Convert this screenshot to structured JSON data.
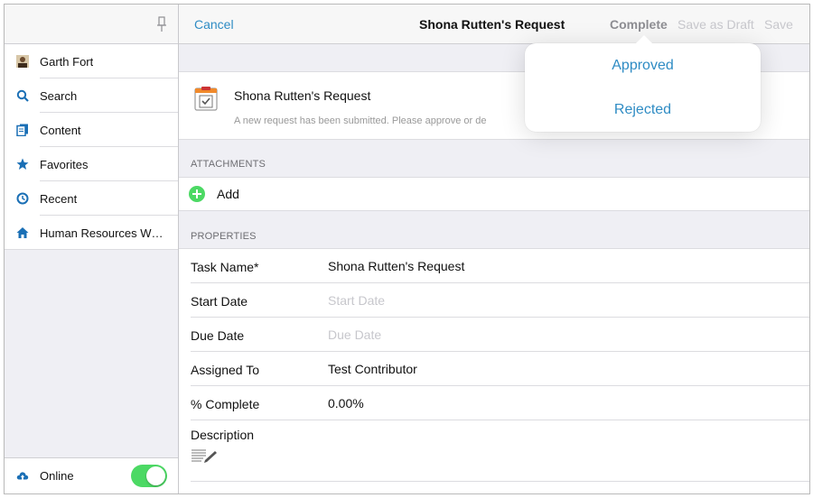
{
  "sidebar": {
    "items": [
      {
        "label": "Garth Fort",
        "icon": "user-avatar-icon"
      },
      {
        "label": "Search",
        "icon": "search-icon"
      },
      {
        "label": "Content",
        "icon": "documents-icon"
      },
      {
        "label": "Favorites",
        "icon": "star-icon"
      },
      {
        "label": "Recent",
        "icon": "clock-icon"
      },
      {
        "label": "Human Resources W…",
        "icon": "home-icon"
      }
    ],
    "footer": {
      "label": "Online",
      "icon": "cloud-upload-icon",
      "toggle_on": true
    }
  },
  "navbar": {
    "cancel_label": "Cancel",
    "title": "Shona Rutten's Request",
    "complete_label": "Complete",
    "save_draft_label": "Save as Draft",
    "save_label": "Save"
  },
  "request": {
    "title": "Shona Rutten's Request",
    "subtitle": "A new request has been submitted. Please approve or de",
    "icon": "task-checklist-icon"
  },
  "attachments": {
    "header": "ATTACHMENTS",
    "add_label": "Add"
  },
  "properties": {
    "header": "PROPERTIES",
    "rows": [
      {
        "label": "Task Name*",
        "value": "Shona Rutten's Request",
        "placeholder": false
      },
      {
        "label": "Start Date",
        "value": "Start Date",
        "placeholder": true
      },
      {
        "label": "Due Date",
        "value": "Due Date",
        "placeholder": true
      },
      {
        "label": "Assigned To",
        "value": "Test Contributor",
        "placeholder": false
      },
      {
        "label": "% Complete",
        "value": "0.00%",
        "placeholder": false
      }
    ],
    "description_label": "Description"
  },
  "popover": {
    "options": [
      "Approved",
      "Rejected"
    ]
  },
  "colors": {
    "accent": "#2f8cc4",
    "toggle_green": "#4cd964",
    "sidebar_icon_blue": "#1a6fb5"
  }
}
